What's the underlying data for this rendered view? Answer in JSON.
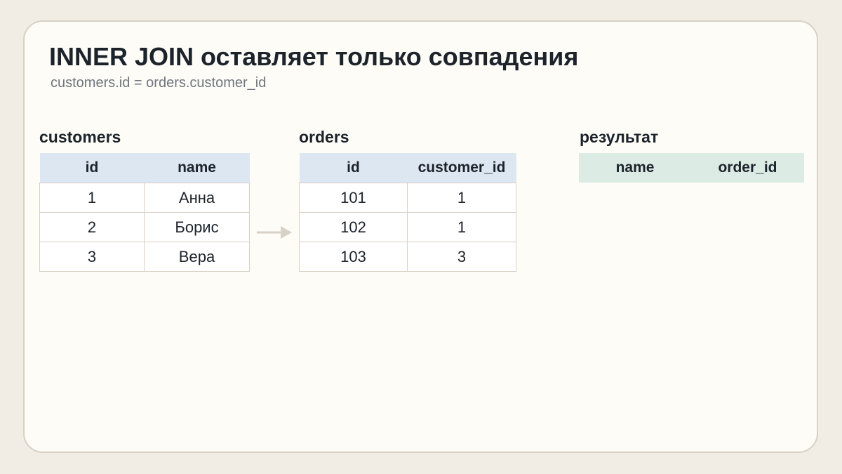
{
  "title": "INNER JOIN оставляет только совпадения",
  "subtitle": "customers.id = orders.customer_id",
  "tables": {
    "customers": {
      "label": "customers",
      "headers": [
        "id",
        "name"
      ],
      "rows": [
        [
          "1",
          "Анна"
        ],
        [
          "2",
          "Борис"
        ],
        [
          "3",
          "Вера"
        ]
      ]
    },
    "orders": {
      "label": "orders",
      "headers": [
        "id",
        "customer_id"
      ],
      "rows": [
        [
          "101",
          "1"
        ],
        [
          "102",
          "1"
        ],
        [
          "103",
          "3"
        ]
      ]
    },
    "result": {
      "label": "результат",
      "headers": [
        "name",
        "order_id"
      ],
      "rows": []
    }
  },
  "colors": {
    "header_blue": "#dde7f1",
    "header_green": "#dcece5",
    "arrow": "#d8d1c5"
  }
}
